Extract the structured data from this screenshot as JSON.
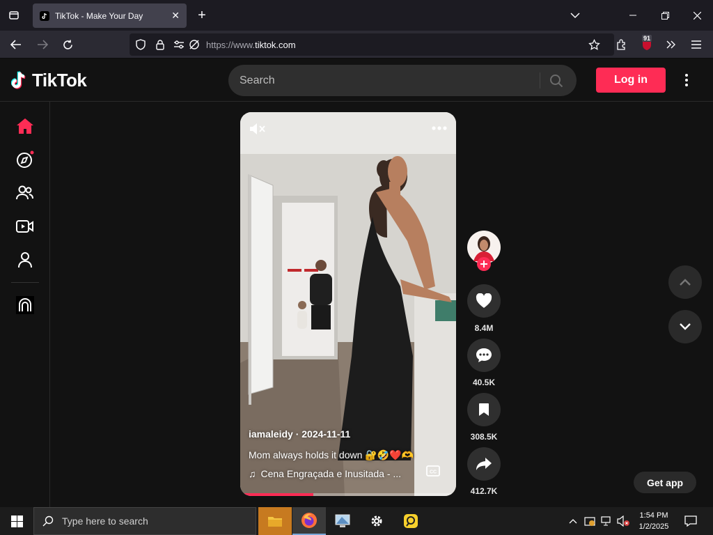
{
  "browser": {
    "tab_title": "TikTok - Make Your Day",
    "url_prefix": "https://www.",
    "url_domain": "tiktok.com",
    "extension_badge": "91"
  },
  "tiktok": {
    "logo_text": "TikTok",
    "search_placeholder": "Search",
    "login_label": "Log in",
    "get_app_label": "Get app",
    "video": {
      "author_line": "iamaleidy · 2024-11-11",
      "description": "Mom always holds it down 🔐🤣❤️🫶",
      "music": "Cena Engraçada e Inusitada - ...",
      "progress": 0.34
    },
    "actions": {
      "likes": "8.4M",
      "comments": "40.5K",
      "saves": "308.5K",
      "shares": "412.7K"
    },
    "brand_color": "#fe2c55"
  },
  "taskbar": {
    "search_placeholder": "Type here to search",
    "time": "1:54 PM",
    "date": "1/2/2025"
  }
}
